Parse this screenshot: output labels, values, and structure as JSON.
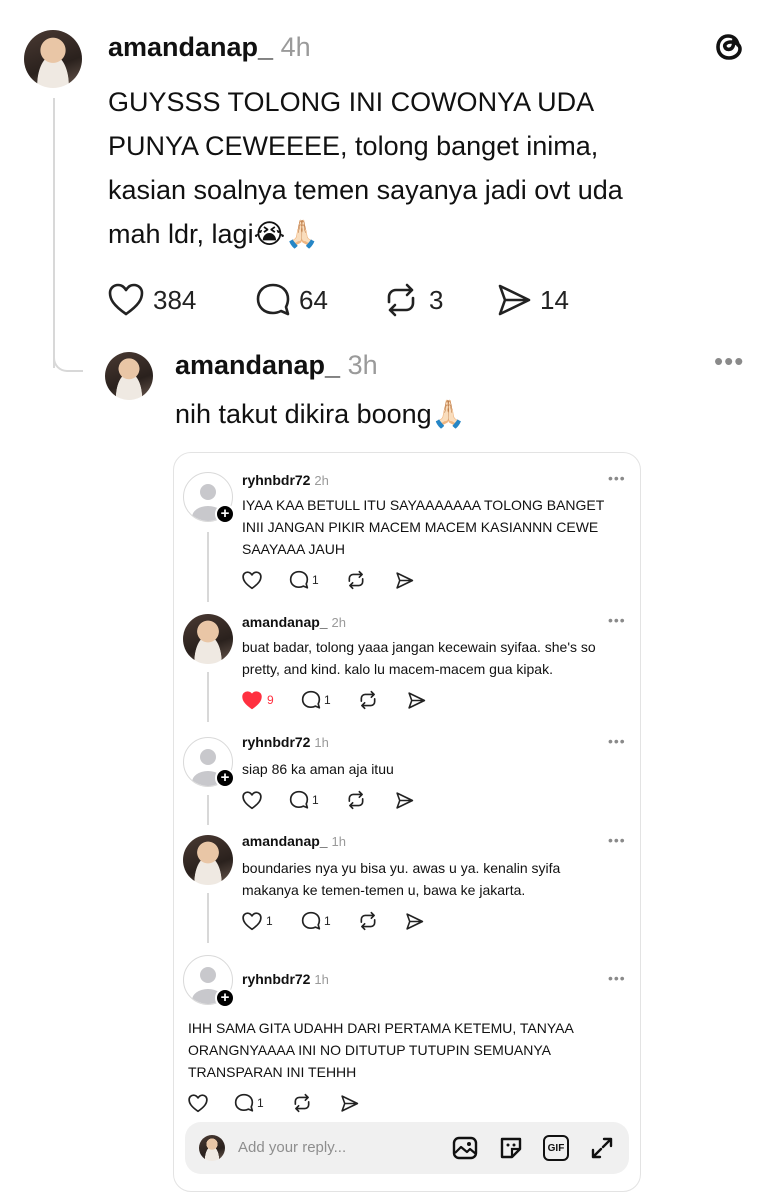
{
  "main_post": {
    "username": "amandanap_",
    "time": "4h",
    "text_lines": [
      "GUYSSS TOLONG INI COWONYA UDA",
      "PUNYA CEWEEEE, tolong banget inima,",
      "kasian soalnya temen sayanya jadi ovt uda",
      "mah ldr, lagi😭🙏🏻"
    ],
    "likes": "384",
    "comments": "64",
    "reposts": "3",
    "shares": "14"
  },
  "reply_post": {
    "username": "amandanap_",
    "time": "3h",
    "text": "nih takut dikira boong🙏🏻"
  },
  "embedded": {
    "comments": [
      {
        "username": "ryhnbdr72",
        "time": "2h",
        "lines": [
          "IYAA KAA BETULL ITU SAYAAAAAAA TOLONG BANGET",
          "INII JANGAN PIKIR MACEM MACEM KASIANNN CEWE",
          "SAAYAAA JAUH"
        ],
        "likes": "",
        "comments": "1"
      },
      {
        "username": "amandanap_",
        "time": "2h",
        "lines": [
          "buat badar, tolong yaaa jangan kecewain syifaa. she's so",
          "pretty, and kind. kalo lu macem-macem gua kipak."
        ],
        "likes": "9",
        "comments": "1"
      },
      {
        "username": "ryhnbdr72",
        "time": "1h",
        "lines": [
          "siap 86 ka aman aja ituu"
        ],
        "likes": "",
        "comments": "1"
      },
      {
        "username": "amandanap_",
        "time": "1h",
        "lines": [
          "boundaries nya yu bisa yu. awas u ya. kenalin syifa",
          "makanya ke temen-temen u, bawa ke jakarta."
        ],
        "likes": "1",
        "comments": "1"
      },
      {
        "username": "ryhnbdr72",
        "time": "1h",
        "lines": [
          "IHH SAMA GITA UDAHH DARI PERTAMA KETEMU, TANYAA",
          "ORANGNYAAAA INI NO DITUTUP TUTUPIN SEMUANYA",
          "TRANSPARAN INI TEHHH"
        ],
        "likes": "",
        "comments": "1"
      }
    ],
    "reply_placeholder": "Add your reply...",
    "gif_label": "GIF"
  },
  "icons": {
    "logo": "threads-logo-icon",
    "like": "heart-icon",
    "comment": "comment-bubble-icon",
    "repost": "repost-icon",
    "share": "send-icon",
    "more": "more-dots-icon"
  },
  "colors": {
    "liked": "#ff3040",
    "muted": "#9a9a9a"
  }
}
